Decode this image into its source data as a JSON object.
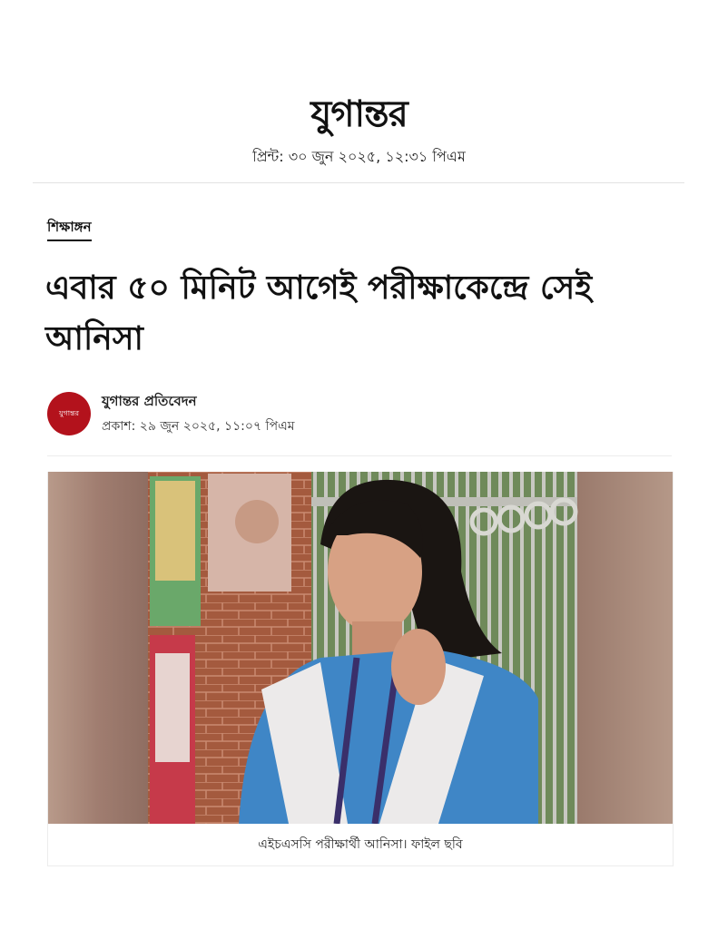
{
  "masthead": {
    "logo_text": "যুগান্তর",
    "print_date": "প্রিন্ট: ৩০ জুন ২০২৫, ১২:৩১ পিএম"
  },
  "article": {
    "category": "শিক্ষাঙ্গন",
    "headline": "এবার ৫০ মিনিট আগেই পরীক্ষাকেন্দ্রে সেই আনিসা",
    "author": "যুগান্তর প্রতিবেদন",
    "published": "প্রকাশ: ২৯ জুন ২০২৫, ১১:০৭ পিএম",
    "avatar_text": "যুগান্তর",
    "photo_caption": "এইচএসসি পরীক্ষার্থী আনিসা। ফাইল ছবি"
  },
  "colors": {
    "avatar_bg": "#b3121c",
    "text": "#111111",
    "rule": "#e2e2e2"
  }
}
